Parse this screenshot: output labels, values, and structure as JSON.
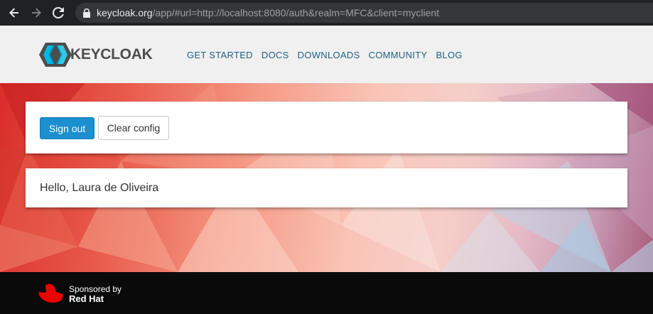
{
  "browser": {
    "url_host": "keycloak.org",
    "url_rest": "/app/#url=http://localhost:8080/auth&realm=MFC&client=myclient"
  },
  "header": {
    "logo_text": "KEYCLOAK",
    "nav": [
      "GET STARTED",
      "DOCS",
      "DOWNLOADS",
      "COMMUNITY",
      "BLOG"
    ]
  },
  "actions": {
    "sign_out_label": "Sign out",
    "clear_config_label": "Clear config"
  },
  "greeting": "Hello, Laura de Oliveira",
  "footer": {
    "sponsored_by": "Sponsored by",
    "brand": "Red Hat"
  },
  "colors": {
    "primary_button": "#1b8fd0",
    "nav_link": "#1f5f85",
    "redhat_red": "#ee0000"
  }
}
